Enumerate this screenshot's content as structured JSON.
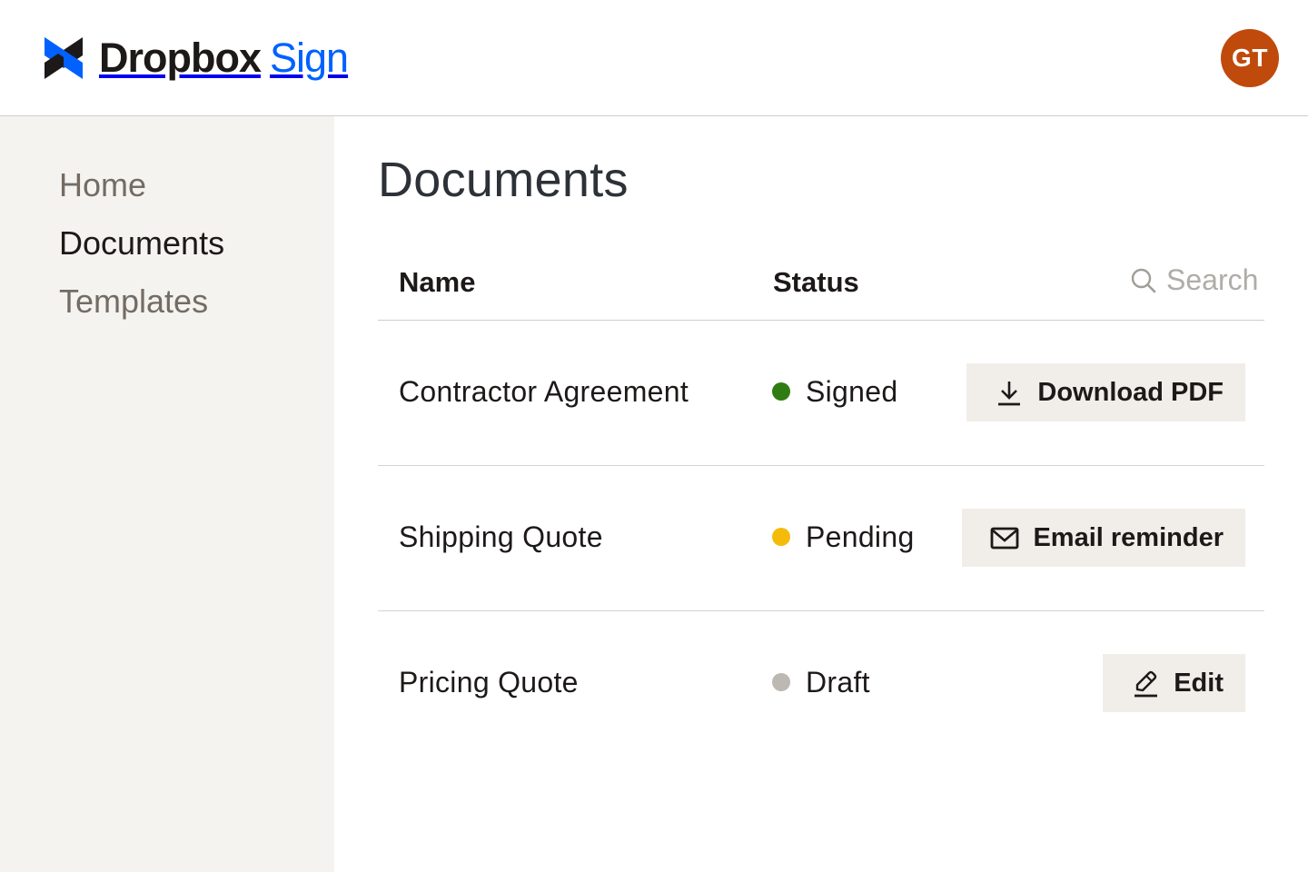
{
  "header": {
    "brand": {
      "primary": "Dropbox",
      "secondary": "Sign"
    },
    "avatar_initials": "GT",
    "colors": {
      "brand_blue": "#0061fe",
      "brand_dark": "#1e1919",
      "avatar_bg": "#c04a0b"
    }
  },
  "sidebar": {
    "items": [
      {
        "label": "Home",
        "active": false
      },
      {
        "label": "Documents",
        "active": true
      },
      {
        "label": "Templates",
        "active": false
      }
    ]
  },
  "main": {
    "title": "Documents",
    "table": {
      "columns": {
        "name": "Name",
        "status": "Status"
      },
      "search": {
        "placeholder": "Search",
        "value": "",
        "icon": "search-icon"
      },
      "rows": [
        {
          "name": "Contractor Agreement",
          "status": "Signed",
          "status_color": "#2f7d12",
          "action": {
            "label": "Download PDF",
            "icon": "download-icon"
          }
        },
        {
          "name": "Shipping Quote",
          "status": "Pending",
          "status_color": "#f5bb0b",
          "action": {
            "label": "Email reminder",
            "icon": "mail-icon"
          }
        },
        {
          "name": "Pricing Quote",
          "status": "Draft",
          "status_color": "#bdb8b2",
          "action": {
            "label": "Edit",
            "icon": "pencil-icon"
          }
        }
      ]
    }
  }
}
